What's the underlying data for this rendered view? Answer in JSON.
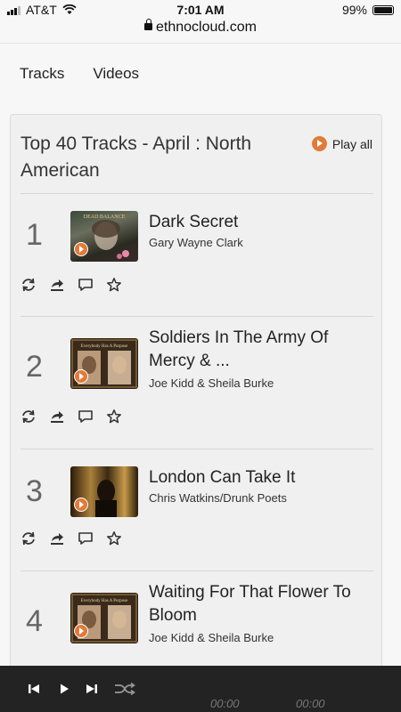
{
  "status_bar": {
    "carrier": "AT&T",
    "time": "7:01 AM",
    "battery": "99%"
  },
  "browser": {
    "url": "ethnocloud.com"
  },
  "nav": {
    "tabs": [
      "Tracks",
      "Videos"
    ]
  },
  "chart": {
    "title": "Top 40 Tracks - April : North American",
    "play_all": "Play all",
    "tracks": [
      {
        "rank": "1",
        "title": "Dark Secret",
        "artist": "Gary Wayne Clark",
        "cover_text": "DEAD BALANCE"
      },
      {
        "rank": "2",
        "title": "Soldiers In The Army Of Mercy & ...",
        "artist": "Joe Kidd & Sheila Burke",
        "cover_text": "Everybody Has A Purpose"
      },
      {
        "rank": "3",
        "title": "London Can Take It",
        "artist": "Chris Watkins/Drunk Poets"
      },
      {
        "rank": "4",
        "title": "Waiting For That Flower To Bloom",
        "artist": "Joe Kidd & Sheila Burke",
        "cover_text": "Everybody Has A Purpose"
      }
    ]
  },
  "player": {
    "current_time": "00:00",
    "duration": "00:00"
  },
  "colors": {
    "accent": "#e07b39",
    "player_bg": "#232323"
  }
}
